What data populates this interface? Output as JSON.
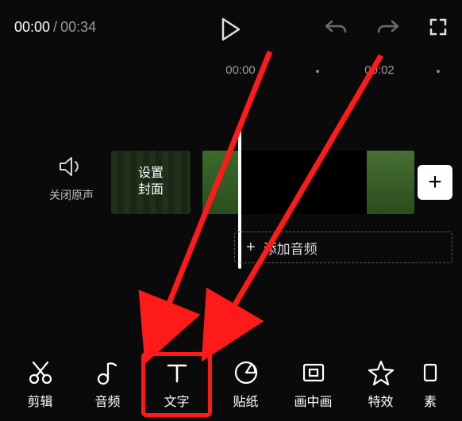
{
  "top": {
    "current_time": "00:00",
    "separator": "/",
    "total_time": "00:34"
  },
  "ruler": {
    "t0": "00:00",
    "t1": "00:02"
  },
  "mute": {
    "label": "关闭原声"
  },
  "cover": {
    "label": "设置\n封面"
  },
  "audio_row": {
    "plus": "+",
    "label": "添加音频"
  },
  "plus_button": "+",
  "tools": [
    {
      "key": "edit",
      "label": "剪辑"
    },
    {
      "key": "audio",
      "label": "音频"
    },
    {
      "key": "text",
      "label": "文字"
    },
    {
      "key": "sticker",
      "label": "贴纸"
    },
    {
      "key": "pip",
      "label": "画中画"
    },
    {
      "key": "fx",
      "label": "特效"
    },
    {
      "key": "material",
      "label": "素"
    }
  ]
}
